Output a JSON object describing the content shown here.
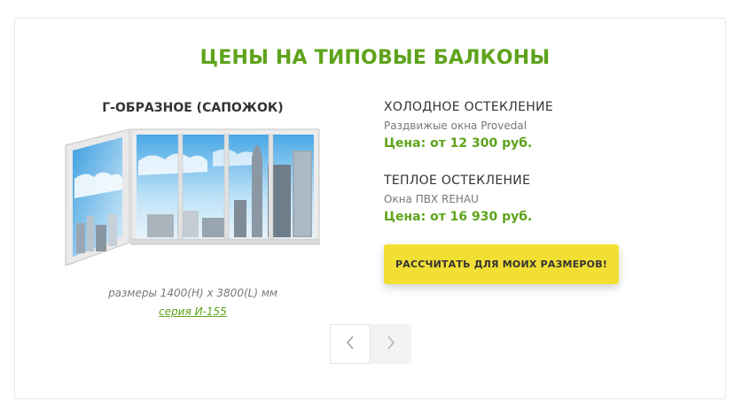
{
  "section": {
    "title": "ЦЕНЫ НА ТИПОВЫЕ БАЛКОНЫ"
  },
  "product": {
    "name": "Г-ОБРАЗНОЕ (САПОЖОК)",
    "dimensions": "размеры 1400(H) x 3800(L) мм",
    "series_link": "серия И-155"
  },
  "options": [
    {
      "title": "ХОЛОДНОЕ ОСТЕКЛЕНИЕ",
      "subtitle": "Раздвижые окна Provedal",
      "price": "Цена: от 12 300 руб."
    },
    {
      "title": "ТЕПЛОЕ ОСТЕКЛЕНИЕ",
      "subtitle": "Окна ПВХ REHAU",
      "price": "Цена: от 16 930 руб."
    }
  ],
  "cta": {
    "label": "РАССЧИТАТЬ ДЛЯ МОИХ РАЗМЕРОВ!"
  },
  "colors": {
    "accent": "#5ea31b",
    "button": "#f2df33"
  },
  "icons": {
    "prev": "chevron-left-icon",
    "next": "chevron-right-icon"
  }
}
